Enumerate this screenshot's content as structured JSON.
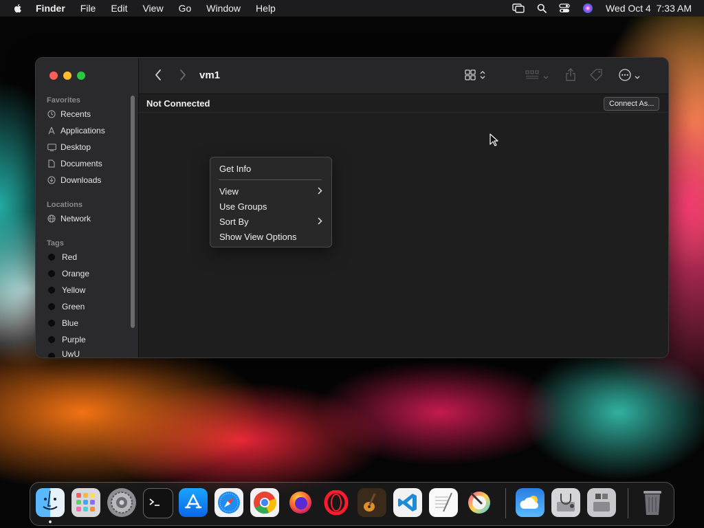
{
  "menubar": {
    "app_name": "Finder",
    "menus": [
      "File",
      "Edit",
      "View",
      "Go",
      "Window",
      "Help"
    ],
    "datetime": "Wed Oct 4  7:33 AM",
    "icons": [
      "apple-icon",
      "screen-mirroring-icon",
      "spotlight-icon",
      "control-center-icon",
      "siri-icon"
    ]
  },
  "window": {
    "title": "vm1",
    "status": "Not Connected",
    "connect_label": "Connect As..."
  },
  "sidebar": {
    "favorites_title": "Favorites",
    "favorites": [
      "Recents",
      "Applications",
      "Desktop",
      "Documents",
      "Downloads"
    ],
    "locations_title": "Locations",
    "locations": [
      "Network"
    ],
    "tags_title": "Tags",
    "tags": [
      "Red",
      "Orange",
      "Yellow",
      "Green",
      "Blue",
      "Purple",
      "UwU"
    ]
  },
  "context_menu": {
    "items": [
      "Get Info",
      "View",
      "Use Groups",
      "Sort By",
      "Show View Options"
    ]
  },
  "dock": {
    "apps": [
      "Finder",
      "Launchpad",
      "System Settings",
      "Terminal",
      "App Store",
      "Safari",
      "Chrome",
      "Firefox",
      "Opera",
      "GarageBand",
      "Visual Studio Code",
      "TextEdit",
      "Pixelmator",
      "Weather",
      "Disk Utility",
      "Boot Camp Assistant",
      "Trash"
    ]
  },
  "colors": {
    "close": "#ff5f57",
    "minimize": "#febc2e",
    "zoom": "#28c840"
  }
}
